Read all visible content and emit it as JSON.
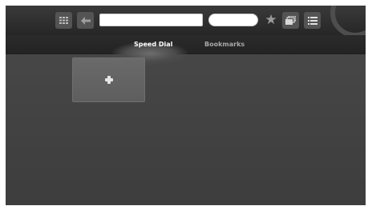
{
  "toolbar": {
    "buttons": [
      {
        "name": "apps-grid",
        "icon": "grid-icon"
      },
      {
        "name": "back",
        "icon": "back-arrow-icon"
      },
      {
        "name": "bookmark",
        "icon": "star-icon"
      },
      {
        "name": "tabs",
        "icon": "tabs-icon"
      },
      {
        "name": "menu",
        "icon": "menu-list-icon"
      }
    ],
    "address_value": "",
    "address_placeholder": "",
    "search_value": "",
    "search_placeholder": ""
  },
  "tabs": [
    {
      "label": "Speed Dial",
      "active": true
    },
    {
      "label": "Bookmarks",
      "active": false
    }
  ],
  "speed_dial": {
    "add_tile_icon": "plus-icon"
  }
}
